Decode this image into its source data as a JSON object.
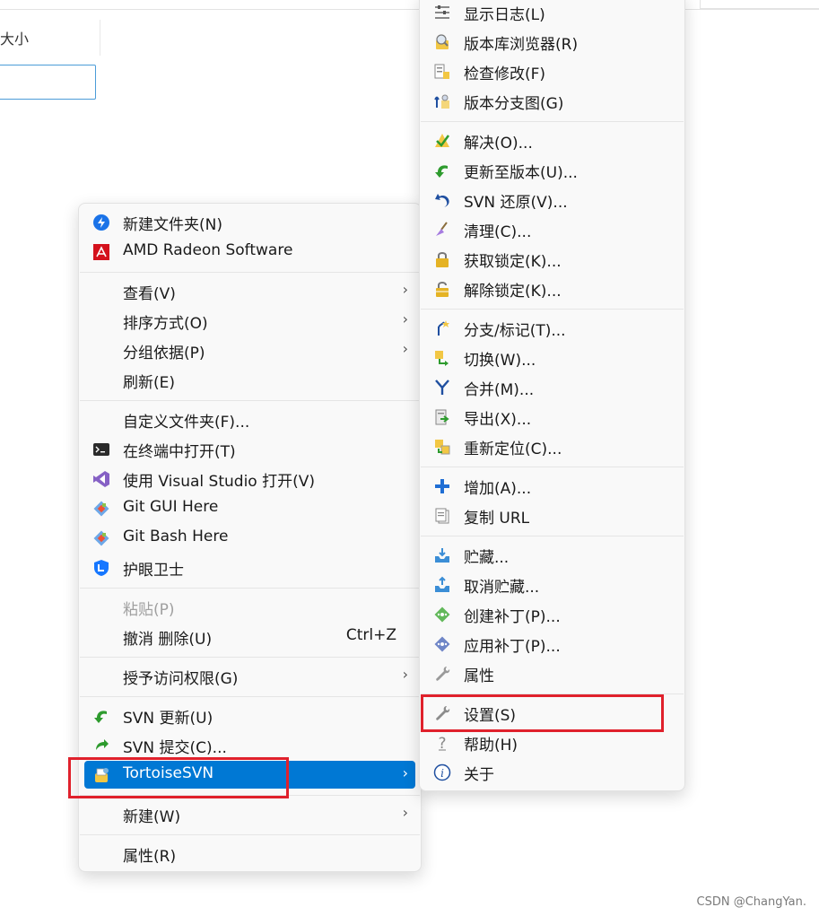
{
  "background": {
    "column_header": "大小"
  },
  "main_menu": {
    "items": [
      {
        "label": "新建文件夹(N)",
        "icon": "new-folder-icon"
      },
      {
        "label": "AMD Radeon Software",
        "icon": "amd-radeon-icon"
      },
      {
        "label": "查看(V)",
        "submenu": true
      },
      {
        "label": "排序方式(O)",
        "submenu": true
      },
      {
        "label": "分组依据(P)",
        "submenu": true
      },
      {
        "label": "刷新(E)"
      },
      {
        "label": "自定义文件夹(F)..."
      },
      {
        "label": "在终端中打开(T)",
        "icon": "terminal-icon"
      },
      {
        "label": "使用 Visual Studio 打开(V)",
        "icon": "visual-studio-icon"
      },
      {
        "label": "Git GUI Here",
        "icon": "git-icon"
      },
      {
        "label": "Git Bash Here",
        "icon": "git-icon"
      },
      {
        "label": "护眼卫士",
        "icon": "eye-guard-icon"
      },
      {
        "label": "粘贴(P)",
        "disabled": true
      },
      {
        "label": "撤消 删除(U)",
        "shortcut": "Ctrl+Z"
      },
      {
        "label": "授予访问权限(G)",
        "submenu": true
      },
      {
        "label": "SVN 更新(U)",
        "icon": "svn-update-icon"
      },
      {
        "label": "SVN 提交(C)...",
        "icon": "svn-commit-icon"
      },
      {
        "label": "TortoiseSVN",
        "icon": "tortoisesvn-icon",
        "submenu": true,
        "selected": true
      },
      {
        "label": "新建(W)",
        "submenu": true
      },
      {
        "label": "属性(R)"
      }
    ],
    "arrow_glyph": "›"
  },
  "sub_menu": {
    "items": [
      {
        "label": "显示日志(L)",
        "icon": "show-log-icon"
      },
      {
        "label": "版本库浏览器(R)",
        "icon": "repo-browser-icon"
      },
      {
        "label": "检查修改(F)",
        "icon": "check-modifications-icon"
      },
      {
        "label": "版本分支图(G)",
        "icon": "revision-graph-icon"
      },
      {
        "label": "解决(O)...",
        "icon": "resolve-icon"
      },
      {
        "label": "更新至版本(U)...",
        "icon": "update-to-revision-icon"
      },
      {
        "label": "SVN 还原(V)...",
        "icon": "revert-icon"
      },
      {
        "label": "清理(C)...",
        "icon": "cleanup-icon"
      },
      {
        "label": "获取锁定(K)...",
        "icon": "lock-icon"
      },
      {
        "label": "解除锁定(K)...",
        "icon": "unlock-icon"
      },
      {
        "label": "分支/标记(T)...",
        "icon": "branch-tag-icon"
      },
      {
        "label": "切换(W)...",
        "icon": "switch-icon"
      },
      {
        "label": "合并(M)...",
        "icon": "merge-icon"
      },
      {
        "label": "导出(X)...",
        "icon": "export-icon"
      },
      {
        "label": "重新定位(C)...",
        "icon": "relocate-icon"
      },
      {
        "label": "增加(A)...",
        "icon": "add-icon"
      },
      {
        "label": "复制 URL",
        "icon": "copy-url-icon"
      },
      {
        "label": "贮藏...",
        "icon": "shelve-icon"
      },
      {
        "label": "取消贮藏...",
        "icon": "unshelve-icon"
      },
      {
        "label": "创建补丁(P)...",
        "icon": "create-patch-icon"
      },
      {
        "label": "应用补丁(P)...",
        "icon": "apply-patch-icon"
      },
      {
        "label": "属性",
        "icon": "properties-wrench-icon"
      },
      {
        "label": "设置(S)",
        "icon": "settings-wrench-icon"
      },
      {
        "label": "帮助(H)",
        "icon": "help-icon"
      },
      {
        "label": "关于",
        "icon": "about-icon"
      }
    ]
  },
  "watermark": "CSDN @ChangYan.",
  "colors": {
    "selection": "#0078d4",
    "highlight_box": "#e0212c",
    "menu_bg": "#f9f9f9"
  }
}
